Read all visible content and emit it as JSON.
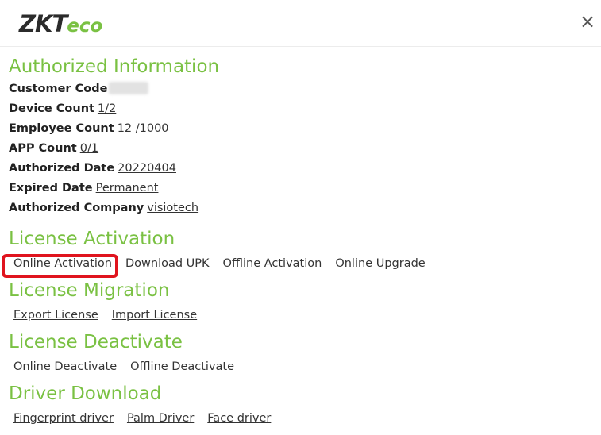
{
  "logo": {
    "zk": "ZK",
    "t": "T",
    "eco": "eco"
  },
  "close_glyph": "×",
  "authorized": {
    "title": "Authorized Information",
    "customer_code_label": "Customer Code",
    "device_count_label": "Device Count",
    "device_count_value": "1/2",
    "employee_count_label": "Employee Count",
    "employee_count_value": "12 /1000",
    "app_count_label": "APP Count",
    "app_count_value": "0/1",
    "authorized_date_label": "Authorized Date",
    "authorized_date_value": "20220404",
    "expired_date_label": "Expired Date",
    "expired_date_value": "Permanent",
    "authorized_company_label": "Authorized Company",
    "authorized_company_value": "visiotech"
  },
  "license_activation": {
    "title": "License Activation",
    "links": [
      "Online Activation",
      "Download UPK",
      "Offline Activation",
      "Online Upgrade"
    ]
  },
  "license_migration": {
    "title": "License Migration",
    "links": [
      "Export License",
      "Import License"
    ]
  },
  "license_deactivate": {
    "title": "License Deactivate",
    "links": [
      "Online Deactivate",
      "Offline Deactivate"
    ]
  },
  "driver_download": {
    "title": "Driver Download",
    "links": [
      "Fingerprint driver",
      "Palm Driver",
      "Face driver"
    ]
  },
  "colors": {
    "accent_green": "#7ac143",
    "highlight_red": "#e0141e"
  }
}
